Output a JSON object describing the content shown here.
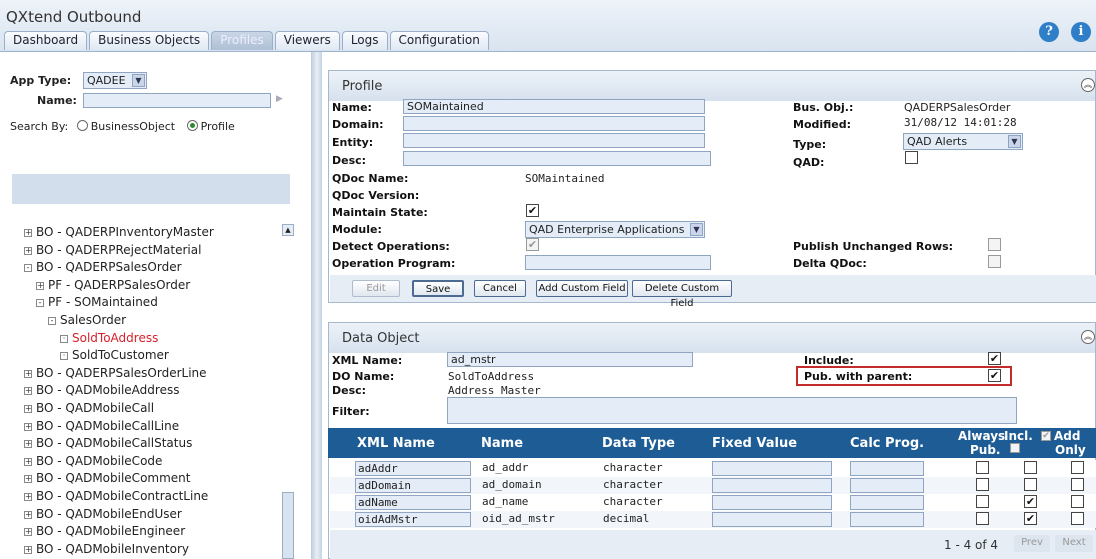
{
  "app": {
    "title": "QXtend Outbound"
  },
  "tabs": [
    {
      "label": "Dashboard"
    },
    {
      "label": "Business Objects"
    },
    {
      "label": "Profiles"
    },
    {
      "label": "Viewers"
    },
    {
      "label": "Logs"
    },
    {
      "label": "Configuration"
    }
  ],
  "header_icons": {
    "help": "?",
    "info": "i"
  },
  "left": {
    "app_type_label": "App Type:",
    "app_type_value": "QADEE",
    "name_label": "Name:",
    "name_value": "",
    "search_by_label": "Search By:",
    "radio_bo": "BusinessObject",
    "radio_profile": "Profile",
    "tree": [
      {
        "label": "BO - QADERPInventoryMaster",
        "sym": "+"
      },
      {
        "label": "BO - QADERPRejectMaterial",
        "sym": "+"
      },
      {
        "label": "BO - QADERPSalesOrder",
        "sym": "-"
      },
      {
        "label": "PF - QADERPSalesOrder",
        "sym": "+"
      },
      {
        "label": "PF - SOMaintained",
        "sym": "-"
      },
      {
        "label": "SalesOrder",
        "sym": "-"
      },
      {
        "label": "SoldToAddress",
        "sym": "▪"
      },
      {
        "label": "SoldToCustomer",
        "sym": "▪"
      },
      {
        "label": "BO - QADERPSalesOrderLine",
        "sym": "+"
      },
      {
        "label": "BO - QADMobileAddress",
        "sym": "+"
      },
      {
        "label": "BO - QADMobileCall",
        "sym": "+"
      },
      {
        "label": "BO - QADMobileCallLine",
        "sym": "+"
      },
      {
        "label": "BO - QADMobileCallStatus",
        "sym": "+"
      },
      {
        "label": "BO - QADMobileCode",
        "sym": "+"
      },
      {
        "label": "BO - QADMobileComment",
        "sym": "+"
      },
      {
        "label": "BO - QADMobileContractLine",
        "sym": "+"
      },
      {
        "label": "BO - QADMobileEndUser",
        "sym": "+"
      },
      {
        "label": "BO - QADMobileEngineer",
        "sym": "+"
      },
      {
        "label": "BO - QADMobileInventory",
        "sym": "+"
      }
    ]
  },
  "profile": {
    "title": "Profile",
    "name_label": "Name:",
    "name_value": "SOMaintained",
    "domain_label": "Domain:",
    "entity_label": "Entity:",
    "desc_label": "Desc:",
    "qdoc_name_label": "QDoc Name:",
    "qdoc_name_value": "SOMaintained",
    "qdoc_version_label": "QDoc Version:",
    "maintain_state_label": "Maintain State:",
    "module_label": "Module:",
    "module_value": "QAD Enterprise Applications",
    "detect_ops_label": "Detect Operations:",
    "op_program_label": "Operation Program:",
    "busobj_label": "Bus. Obj.:",
    "busobj_value": "QADERPSalesOrder",
    "modified_label": "Modified:",
    "modified_value": "31/08/12 14:01:28",
    "type_label": "Type:",
    "type_value": "QAD Alerts",
    "qad_label": "QAD:",
    "publish_unchanged_label": "Publish Unchanged Rows:",
    "delta_label": "Delta QDoc:",
    "btn_edit": "Edit",
    "btn_save": "Save",
    "btn_cancel": "Cancel",
    "btn_add_custom": "Add Custom Field",
    "btn_delete_custom": "Delete Custom Field"
  },
  "dataobject": {
    "title": "Data Object",
    "xml_name_label": "XML Name:",
    "xml_name_value": "ad_mstr",
    "do_name_label": "DO Name:",
    "do_name_value": "SoldToAddress",
    "desc_label": "Desc:",
    "desc_value": "Address Master",
    "filter_label": "Filter:",
    "include_label": "Include:",
    "pub_parent_label": "Pub. with parent:",
    "columns": {
      "xml_name": "XML Name",
      "name": "Name",
      "data_type": "Data Type",
      "fixed_value": "Fixed Value",
      "calc_prog": "Calc Prog.",
      "always_pub_1": "Always",
      "always_pub_2": "Pub.",
      "incl": "Incl.",
      "add_only_1": "Add",
      "add_only_2": "Only"
    },
    "rows": [
      {
        "xml": "adAddr",
        "name": "ad_addr",
        "type": "character"
      },
      {
        "xml": "adDomain",
        "name": "ad_domain",
        "type": "character"
      },
      {
        "xml": "adName",
        "name": "ad_name",
        "type": "character"
      },
      {
        "xml": "oidAdMstr",
        "name": "oid_ad_mstr",
        "type": "decimal"
      }
    ],
    "paging": "1 - 4 of 4",
    "prev": "Prev",
    "next": "Next"
  }
}
